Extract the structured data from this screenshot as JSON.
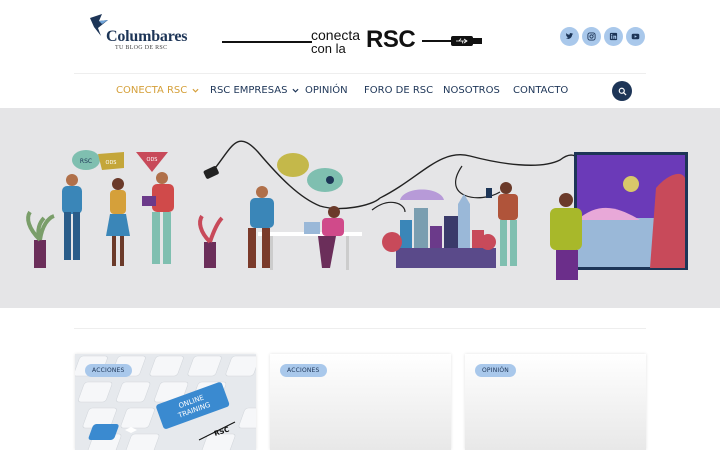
{
  "header": {
    "logo_name": "Columbares",
    "logo_tagline": "TU BLOG DE RSC",
    "banner": {
      "line1": "conecta",
      "line2": "con la",
      "big": "RSC"
    },
    "social": [
      {
        "icon": "twitter-icon"
      },
      {
        "icon": "instagram-icon"
      },
      {
        "icon": "linkedin-icon"
      },
      {
        "icon": "youtube-icon"
      }
    ]
  },
  "nav": {
    "items": [
      {
        "label": "CONECTA RSC",
        "active": true,
        "dropdown": true
      },
      {
        "label": "RSC EMPRESAS",
        "active": false,
        "dropdown": true
      },
      {
        "label": "OPINIÓN",
        "active": false,
        "dropdown": false
      },
      {
        "label": "FORO DE RSC",
        "active": false,
        "dropdown": false
      },
      {
        "label": "NOSOTROS",
        "active": false,
        "dropdown": false
      },
      {
        "label": "CONTACTO",
        "active": false,
        "dropdown": false
      }
    ],
    "search_icon": "search-icon"
  },
  "hero": {
    "bubbles": [
      "RSC",
      "ODS",
      "ODS"
    ]
  },
  "cards": [
    {
      "badge": "ACCIONES",
      "key_text": "ONLINE TRAINING",
      "stamp": "RSC"
    },
    {
      "badge": "ACCIONES"
    },
    {
      "badge": "OPINIÓN"
    }
  ],
  "colors": {
    "accent": "#d5a03a",
    "navy": "#1d3557",
    "badge": "#a9c8eb",
    "hero_bg": "#e5e5e7"
  }
}
